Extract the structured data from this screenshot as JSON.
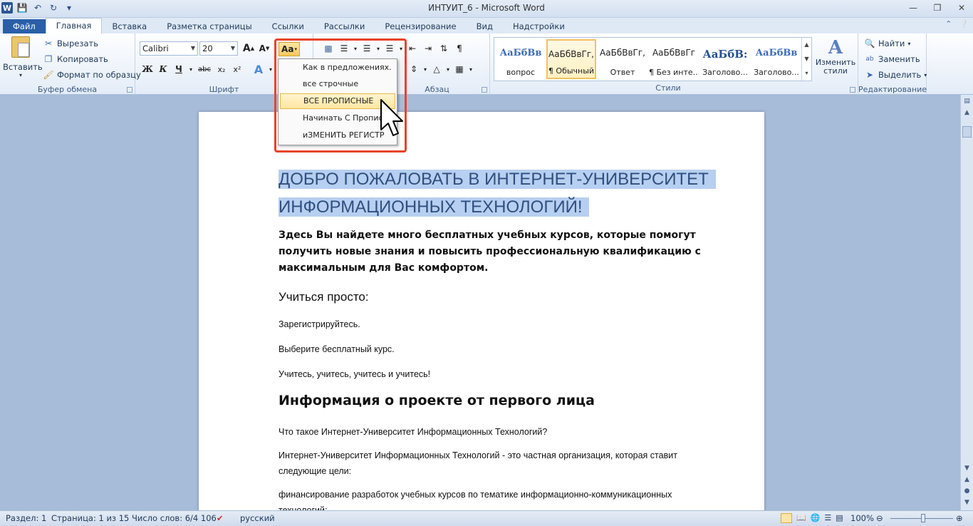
{
  "window": {
    "title": "ИНТУИТ_6 - Microsoft Word"
  },
  "tabs": [
    "Файл",
    "Главная",
    "Вставка",
    "Разметка страницы",
    "Ссылки",
    "Рассылки",
    "Рецензирование",
    "Вид",
    "Надстройки"
  ],
  "clipboard": {
    "paste": "Вставить",
    "cut": "Вырезать",
    "copy": "Копировать",
    "format_painter": "Формат по образцу",
    "label": "Буфер обмена"
  },
  "font": {
    "name": "Calibri",
    "size": "20",
    "label": "Шрифт",
    "bold": "Ж",
    "italic": "К",
    "underline": "Ч",
    "strike": "abc",
    "grow": "A",
    "shrink": "A",
    "change_case": "Aa"
  },
  "paragraph": {
    "label": "Абзац"
  },
  "styles": {
    "label": "Стили",
    "items": [
      {
        "sample": "АаБбВв",
        "name": "вопрос"
      },
      {
        "sample": "АаБбВвГг,",
        "name": "¶ Обычный"
      },
      {
        "sample": "АаБбВвГг,",
        "name": "Ответ"
      },
      {
        "sample": "АаБбВвГг",
        "name": "¶ Без инте..."
      },
      {
        "sample": "АаБбВ:",
        "name": "Заголово..."
      },
      {
        "sample": "АаБбВв",
        "name": "Заголово..."
      }
    ],
    "change_styles": "Изменить стили"
  },
  "editing": {
    "label": "Редактирование",
    "find": "Найти",
    "replace": "Заменить",
    "select": "Выделить"
  },
  "case_menu": {
    "items": [
      "Как в предложениях.",
      "все строчные",
      "ВСЕ ПРОПИСНЫЕ",
      "Начинать С Прописных",
      "иЗМЕНИТЬ РЕГИСТР"
    ]
  },
  "document": {
    "title_line1": "ДОБРО ПОЖАЛОВАТЬ В ИНТЕРНЕТ-УНИВЕРСИТЕТ",
    "title_line2": "ИНФОРМАЦИОННЫХ ТЕХНОЛОГИЙ!",
    "intro": "Здесь Вы найдете много бесплатных учебных курсов, которые помогут получить новые знания и повысить профессиональную квалификацию с максимальным для Вас комфортом.",
    "subheading": "Учиться просто:",
    "p1": "Зарегистрируйтесь.",
    "p2": "Выберите бесплатный курс.",
    "p3": "Учитесь, учитесь, учитесь и учитесь!",
    "heading1": "Информация о проекте от первого лица",
    "p4": "Что такое Интернет-Университет Информационных Технологий?",
    "p5": "Интернет-Университет Информационных Технологий - это частная организация, которая ставит следующие цели:",
    "p6": "финансирование разработок учебных курсов по тематике информационно-коммуникационных технологий;"
  },
  "status": {
    "section": "Раздел: 1",
    "page": "Страница: 1 из 15",
    "words": "Число слов: 6/4 106",
    "language": "русский",
    "zoom": "100%"
  }
}
